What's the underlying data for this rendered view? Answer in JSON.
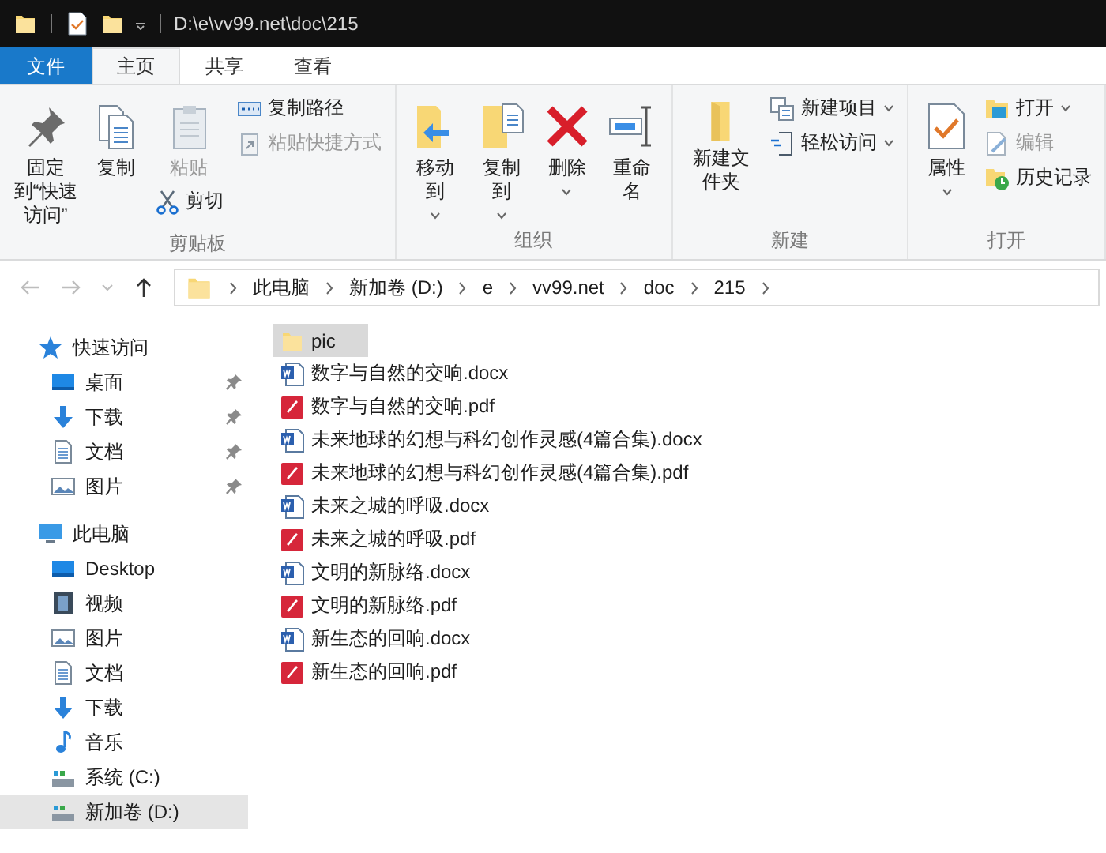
{
  "title_bar": {
    "quick_access": [
      {
        "kind": "folder"
      },
      {
        "kind": "properties"
      },
      {
        "kind": "folder"
      }
    ],
    "path": "D:\\e\\vv99.net\\doc\\215"
  },
  "ribbon_tabs": [
    {
      "label": "文件",
      "kind": "file",
      "selected": false
    },
    {
      "label": "主页",
      "kind": "tab",
      "selected": true
    },
    {
      "label": "共享",
      "kind": "tab",
      "selected": false
    },
    {
      "label": "查看",
      "kind": "tab",
      "selected": false
    }
  ],
  "ribbon_groups": [
    {
      "label": "剪贴板",
      "columns": [
        {
          "kind": "large",
          "items": [
            {
              "label": "固定到“快速访问”",
              "kind": "pin",
              "disabled": false,
              "dropdown": false
            }
          ]
        },
        {
          "kind": "large",
          "items": [
            {
              "label": "复制",
              "kind": "copy",
              "disabled": false,
              "dropdown": false
            }
          ]
        },
        {
          "kind": "large",
          "items": [
            {
              "label": "粘贴",
              "kind": "paste",
              "disabled": true,
              "dropdown": false
            },
            {
              "label": "剪切",
              "kind": "cut",
              "disabled": false,
              "dropdown": false
            }
          ]
        },
        {
          "kind": "small",
          "items": [
            {
              "label": "复制路径",
              "kind": "copypath",
              "disabled": false,
              "dropdown": false
            },
            {
              "label": "粘贴快捷方式",
              "kind": "pasteshortcut",
              "disabled": true,
              "dropdown": false
            }
          ]
        }
      ]
    },
    {
      "label": "组织",
      "columns": [
        {
          "kind": "large",
          "items": [
            {
              "label": "移动到",
              "kind": "moveto",
              "disabled": false,
              "dropdown": true
            }
          ]
        },
        {
          "kind": "large",
          "items": [
            {
              "label": "复制到",
              "kind": "copyto",
              "disabled": false,
              "dropdown": true
            }
          ]
        },
        {
          "kind": "large",
          "items": [
            {
              "label": "删除",
              "kind": "delete",
              "disabled": false,
              "dropdown": true
            }
          ]
        },
        {
          "kind": "large",
          "items": [
            {
              "label": "重命名",
              "kind": "rename",
              "disabled": false,
              "dropdown": false
            }
          ]
        }
      ]
    },
    {
      "label": "新建",
      "columns": [
        {
          "kind": "large",
          "items": [
            {
              "label": "新建文件夹",
              "kind": "newfolder",
              "disabled": false,
              "dropdown": false
            }
          ]
        },
        {
          "kind": "small",
          "items": [
            {
              "label": "新建项目",
              "kind": "newitem",
              "disabled": false,
              "dropdown": true
            },
            {
              "label": "轻松访问",
              "kind": "easyaccess",
              "disabled": false,
              "dropdown": true
            }
          ]
        }
      ]
    },
    {
      "label": "打开",
      "columns": [
        {
          "kind": "large",
          "items": [
            {
              "label": "属性",
              "kind": "properties",
              "disabled": false,
              "dropdown": true
            }
          ]
        },
        {
          "kind": "small",
          "items": [
            {
              "label": "打开",
              "kind": "open",
              "disabled": false,
              "dropdown": true
            },
            {
              "label": "编辑",
              "kind": "edit",
              "disabled": true,
              "dropdown": false
            },
            {
              "label": "历史记录",
              "kind": "history",
              "disabled": false,
              "dropdown": false
            }
          ]
        }
      ]
    }
  ],
  "address_bar": {
    "back_disabled": true,
    "forward_disabled": true,
    "segments": [
      "此电脑",
      "新加卷 (D:)",
      "e",
      "vv99.net",
      "doc",
      "215"
    ]
  },
  "navigation": [
    {
      "label": "快速访问",
      "kind": "star",
      "selected": false,
      "children": [
        {
          "label": "桌面",
          "kind": "desktop",
          "pinned": true,
          "selected": false
        },
        {
          "label": "下载",
          "kind": "download",
          "pinned": true,
          "selected": false
        },
        {
          "label": "文档",
          "kind": "document",
          "pinned": true,
          "selected": false
        },
        {
          "label": "图片",
          "kind": "picture",
          "pinned": true,
          "selected": false
        }
      ]
    },
    {
      "label": "此电脑",
      "kind": "pc",
      "selected": false,
      "children": [
        {
          "label": "Desktop",
          "kind": "desktop",
          "pinned": false,
          "selected": false
        },
        {
          "label": "视频",
          "kind": "video",
          "pinned": false,
          "selected": false
        },
        {
          "label": "图片",
          "kind": "picture",
          "pinned": false,
          "selected": false
        },
        {
          "label": "文档",
          "kind": "document",
          "pinned": false,
          "selected": false
        },
        {
          "label": "下载",
          "kind": "download",
          "pinned": false,
          "selected": false
        },
        {
          "label": "音乐",
          "kind": "music",
          "pinned": false,
          "selected": false
        },
        {
          "label": "系统 (C:)",
          "kind": "drive",
          "pinned": false,
          "selected": false
        },
        {
          "label": "新加卷 (D:)",
          "kind": "drive",
          "pinned": false,
          "selected": true
        }
      ]
    }
  ],
  "files": [
    {
      "name": "pic",
      "kind": "folder",
      "selected": true
    },
    {
      "name": "数字与自然的交响.docx",
      "kind": "docx",
      "selected": false
    },
    {
      "name": "数字与自然的交响.pdf",
      "kind": "pdf",
      "selected": false
    },
    {
      "name": "未来地球的幻想与科幻创作灵感(4篇合集).docx",
      "kind": "docx",
      "selected": false
    },
    {
      "name": "未来地球的幻想与科幻创作灵感(4篇合集).pdf",
      "kind": "pdf",
      "selected": false
    },
    {
      "name": "未来之城的呼吸.docx",
      "kind": "docx",
      "selected": false
    },
    {
      "name": "未来之城的呼吸.pdf",
      "kind": "pdf",
      "selected": false
    },
    {
      "name": "文明的新脉络.docx",
      "kind": "docx",
      "selected": false
    },
    {
      "name": "文明的新脉络.pdf",
      "kind": "pdf",
      "selected": false
    },
    {
      "name": "新生态的回响.docx",
      "kind": "docx",
      "selected": false
    },
    {
      "name": "新生态的回响.pdf",
      "kind": "pdf",
      "selected": false
    }
  ]
}
